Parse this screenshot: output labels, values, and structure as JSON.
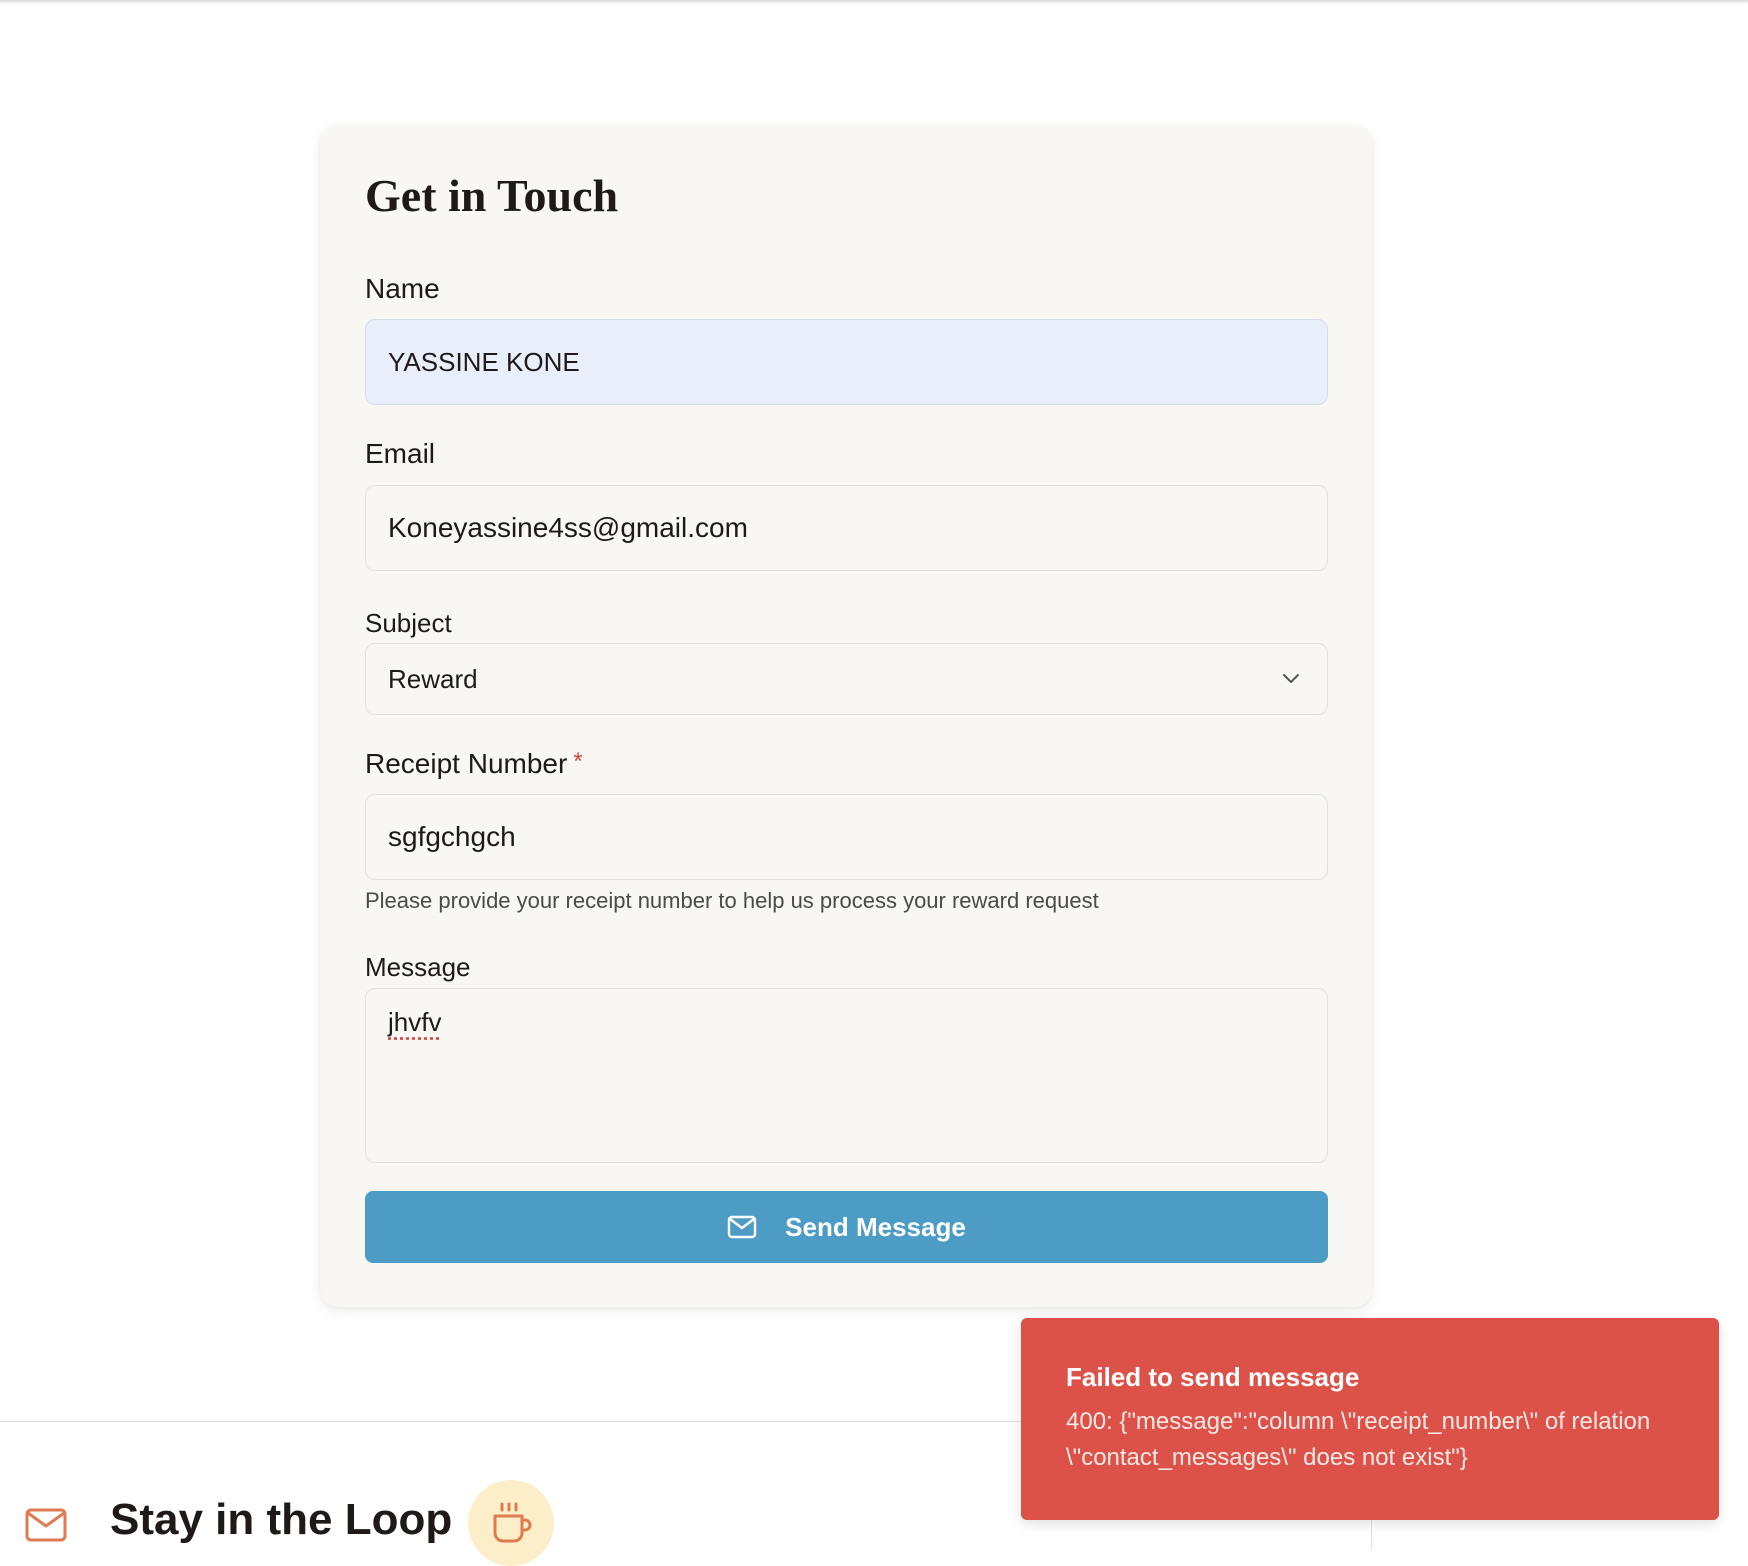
{
  "colors": {
    "accent": "#4c9cc6",
    "error": "#dc5248",
    "card_bg": "#f9f7f3",
    "autofill_bg": "#e8effb",
    "loop_icon": "#e07a4f",
    "badge_bg": "#fbeec9"
  },
  "contact_form": {
    "title": "Get in Touch",
    "name": {
      "label": "Name",
      "value": "YASSINE KONE"
    },
    "email": {
      "label": "Email",
      "value": "Koneyassine4ss@gmail.com"
    },
    "subject": {
      "label": "Subject",
      "value": "Reward",
      "icon": "chevron-down-icon"
    },
    "receipt": {
      "label": "Receipt Number",
      "required_mark": "*",
      "value": "sgfgchgch",
      "help": "Please provide your receipt number to help us process your reward request"
    },
    "message": {
      "label": "Message",
      "value": "jhvfv"
    },
    "submit": {
      "label": "Send Message",
      "icon": "mail-icon"
    }
  },
  "newsletter": {
    "title": "Stay in the Loop",
    "icon": "mail-icon",
    "badge_icon": "coffee-cup-icon"
  },
  "toast": {
    "title": "Failed to send message",
    "message": "400: {\"message\":\"column \\\"receipt_number\\\" of relation \\\"contact_messages\\\" does not exist\"}"
  }
}
